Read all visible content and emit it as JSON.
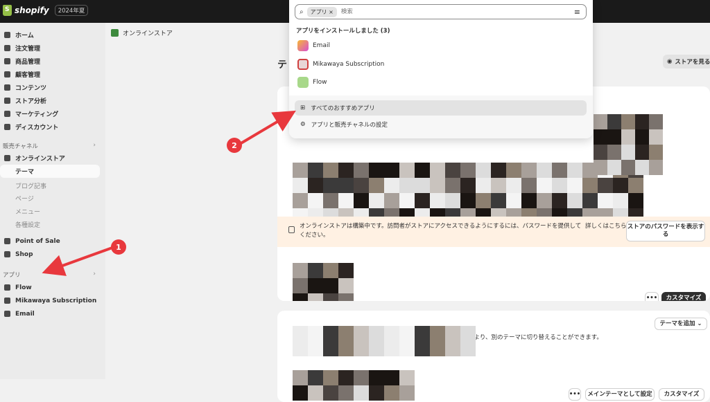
{
  "topbar": {
    "brand": "shopify",
    "badge": "2024年夏"
  },
  "sidebar": {
    "items": [
      {
        "label": "ホーム",
        "icon": "home-icon"
      },
      {
        "label": "注文管理",
        "icon": "inbox-icon"
      },
      {
        "label": "商品管理",
        "icon": "tag-icon"
      },
      {
        "label": "顧客管理",
        "icon": "person-icon"
      },
      {
        "label": "コンテンツ",
        "icon": "image-icon"
      },
      {
        "label": "ストア分析",
        "icon": "bar-chart-icon"
      },
      {
        "label": "マーケティング",
        "icon": "target-icon"
      },
      {
        "label": "ディスカウント",
        "icon": "discount-icon"
      }
    ],
    "sales_channel_heading": "販売チャネル",
    "online_store": "オンラインストア",
    "online_store_sub": [
      "テーマ",
      "ブログ記事",
      "ページ",
      "メニュー",
      "各種設定"
    ],
    "point_of_sale": "Point of Sale",
    "shop": "Shop",
    "apps_heading": "アプリ",
    "apps": [
      "Flow",
      "Mikawaya Subscription",
      "Email"
    ]
  },
  "main": {
    "breadcrumb": "オンラインストア",
    "heading": "テ",
    "view_store": "ストアを見る",
    "notice": "オンラインストアは構築中です。訪問者がストアにアクセスできるようにするには、パスワードを提供してください。",
    "notice_more": "詳しくはこちら",
    "password_button": "ストアのパスワードを表示する",
    "more_button": "•••",
    "customize_button": "カスタマイズ",
    "add_theme_button": "テーマを追加",
    "library_text": "ことにより、別のテーマに切り替えることができます。",
    "set_main_button": "メインテーマとして設定"
  },
  "dropdown": {
    "chip": "アプリ",
    "chip_close": "×",
    "search_placeholder": "検索",
    "installed_heading": "アプリをインストールしました (3)",
    "apps": [
      "Email",
      "Mikawaya Subscription",
      "Flow"
    ],
    "recommended": "すべてのおすすめアプリ",
    "settings": "アプリと販売チャネルの設定"
  },
  "annotations": {
    "first": "1",
    "second": "2",
    "color": "#e8383d"
  }
}
